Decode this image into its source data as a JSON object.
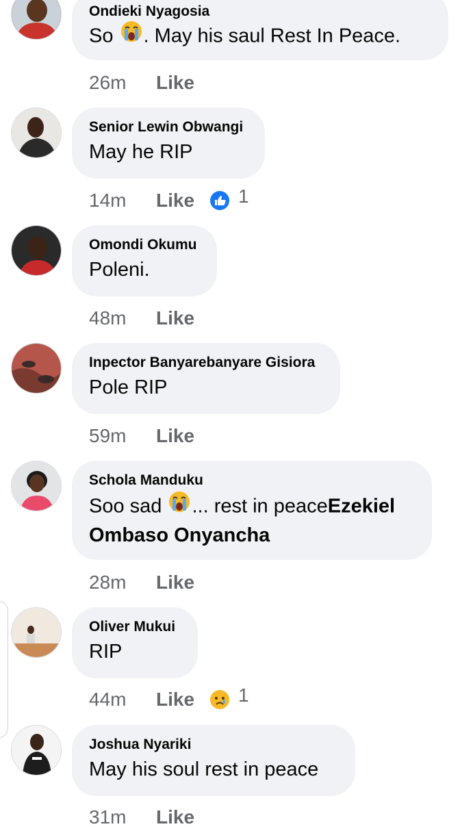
{
  "comments": [
    {
      "author": "Ondieki Nyagosia",
      "pre": "So",
      "post": ". May his saul Rest In Peace.",
      "time": "26m",
      "like": "Like"
    },
    {
      "author": "Senior Lewin Obwangi",
      "text": "May he RIP",
      "time": "14m",
      "like": "Like",
      "reaction_count": "1",
      "reaction_icon": "thumbs-up"
    },
    {
      "author": "Omondi Okumu",
      "text": "Poleni.",
      "time": "48m",
      "like": "Like"
    },
    {
      "author": "Inpector Banyarebanyare Gisiora",
      "text": "Pole RIP",
      "time": "59m",
      "like": "Like"
    },
    {
      "author": "Schola Manduku",
      "pre": "Soo sad",
      "post": "... rest in peace",
      "mention": "Ezekiel Ombaso Onyancha",
      "time": "28m",
      "like": "Like"
    },
    {
      "author": "Oliver Mukui",
      "text": "RIP",
      "time": "44m",
      "like": "Like",
      "reaction_count": "1",
      "reaction_icon": "sad-face"
    },
    {
      "author": "Joshua Nyariki",
      "text": "May his soul rest in peace",
      "time": "31m",
      "like": "Like"
    }
  ],
  "colors": {
    "bubble": "#f0f2f5",
    "meta": "#65676b",
    "like_blue": "#1877f2",
    "sad_yellow": "#f7b928"
  }
}
